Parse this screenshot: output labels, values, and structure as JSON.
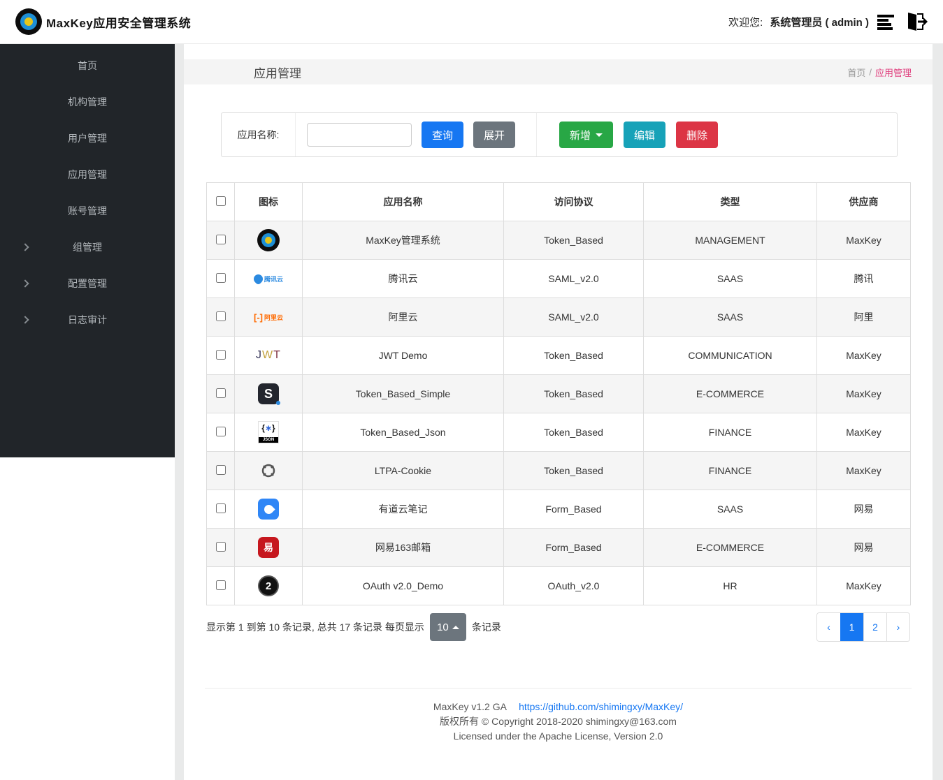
{
  "header": {
    "app_title": "MaxKey应用安全管理系统",
    "welcome_label": "欢迎您:",
    "user_label": "系统管理员 ( admin )"
  },
  "sidebar": {
    "items": [
      {
        "label": "首页",
        "has_children": false
      },
      {
        "label": "机构管理",
        "has_children": false
      },
      {
        "label": "用户管理",
        "has_children": false
      },
      {
        "label": "应用管理",
        "has_children": false
      },
      {
        "label": "账号管理",
        "has_children": false
      },
      {
        "label": "组管理",
        "has_children": true
      },
      {
        "label": "配置管理",
        "has_children": true
      },
      {
        "label": "日志审计",
        "has_children": true
      }
    ]
  },
  "breadcrumb": {
    "page_title": "应用管理",
    "root": "首页",
    "separator": "/",
    "current": "应用管理"
  },
  "filter": {
    "label": "应用名称:",
    "input_value": "",
    "query_button": "查询",
    "expand_button": "展开",
    "add_button": "新增",
    "edit_button": "编辑",
    "delete_button": "删除"
  },
  "table": {
    "columns": [
      "图标",
      "应用名称",
      "访问协议",
      "类型",
      "供应商"
    ],
    "rows": [
      {
        "icon": "maxkey",
        "name": "MaxKey管理系统",
        "protocol": "Token_Based",
        "type": "MANAGEMENT",
        "vendor": "MaxKey"
      },
      {
        "icon": "tencent-cloud",
        "name": "腾讯云",
        "protocol": "SAML_v2.0",
        "type": "SAAS",
        "vendor": "腾讯"
      },
      {
        "icon": "alibaba-cloud",
        "name": "阿里云",
        "protocol": "SAML_v2.0",
        "type": "SAAS",
        "vendor": "阿里"
      },
      {
        "icon": "jwt",
        "name": "JWT Demo",
        "protocol": "Token_Based",
        "type": "COMMUNICATION",
        "vendor": "MaxKey"
      },
      {
        "icon": "s-letter",
        "name": "Token_Based_Simple",
        "protocol": "Token_Based",
        "type": "E-COMMERCE",
        "vendor": "MaxKey"
      },
      {
        "icon": "json",
        "name": "Token_Based_Json",
        "protocol": "Token_Based",
        "type": "FINANCE",
        "vendor": "MaxKey"
      },
      {
        "icon": "ltpa",
        "name": "LTPA-Cookie",
        "protocol": "Token_Based",
        "type": "FINANCE",
        "vendor": "MaxKey"
      },
      {
        "icon": "youdao-note",
        "name": "有道云笔记",
        "protocol": "Form_Based",
        "type": "SAAS",
        "vendor": "网易"
      },
      {
        "icon": "netease-163",
        "name": "网易163邮箱",
        "protocol": "Form_Based",
        "type": "E-COMMERCE",
        "vendor": "网易"
      },
      {
        "icon": "oauth2",
        "name": "OAuth v2.0_Demo",
        "protocol": "OAuth_v2.0",
        "type": "HR",
        "vendor": "MaxKey"
      }
    ]
  },
  "pagination": {
    "info_prefix": "显示第 1 到第 10 条记录, 总共 17 条记录  每页显示",
    "page_size": "10",
    "info_suffix": "条记录",
    "prev": "‹",
    "pages": [
      "1",
      "2"
    ],
    "active_page": "1",
    "next": "›"
  },
  "footer": {
    "version": "MaxKey  v1.2 GA",
    "link": "https://github.com/shimingxy/MaxKey/",
    "copyright": "版权所有 © Copyright 2018-2020 shimingxy@163.com",
    "license": "Licensed under the Apache License, Version 2.0"
  },
  "colors": {
    "primary_blue": "#1677f2",
    "green": "#28a745",
    "teal": "#17a2b8",
    "red": "#dc3545",
    "gray": "#6c757d",
    "breadcrumb_active": "#e0417f",
    "sidebar_bg": "#212529"
  }
}
